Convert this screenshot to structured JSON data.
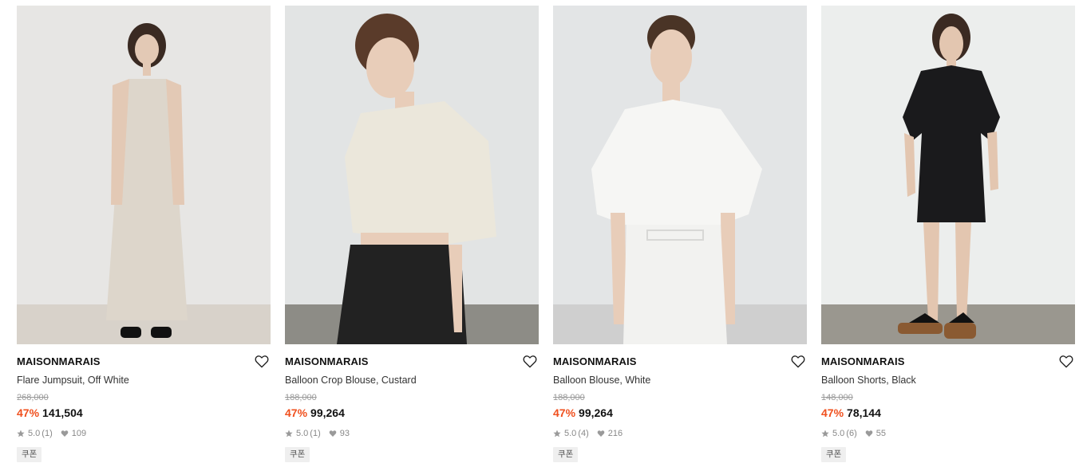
{
  "products": [
    {
      "brand": "MAISONMARAIS",
      "name": "Flare Jumpsuit, Off White",
      "original_price": "268,000",
      "discount": "47%",
      "price": "141,504",
      "rating": "5.0",
      "review_count": "(1)",
      "likes": "109",
      "badge": "쿠폰",
      "photo": {
        "bg": "#e7e6e4",
        "floor": "#d8d2ca",
        "garment": "#ddd6cb",
        "lower": "#ddd6cb",
        "hair": "#3a2a22",
        "skin": "#e3c9b5",
        "type": "jumpsuit"
      }
    },
    {
      "brand": "MAISONMARAIS",
      "name": "Balloon Crop Blouse, Custard",
      "original_price": "188,000",
      "discount": "47%",
      "price": "99,264",
      "rating": "5.0",
      "review_count": "(1)",
      "likes": "93",
      "badge": "쿠폰",
      "photo": {
        "bg": "#e2e4e4",
        "floor": "#8d8c86",
        "garment": "#ebe7db",
        "lower": "#222222",
        "hair": "#5a3b2a",
        "skin": "#e8cdb9",
        "type": "crop"
      }
    },
    {
      "brand": "MAISONMARAIS",
      "name": "Balloon Blouse, White",
      "original_price": "188,000",
      "discount": "47%",
      "price": "99,264",
      "rating": "5.0",
      "review_count": "(4)",
      "likes": "216",
      "badge": "쿠폰",
      "photo": {
        "bg": "#e3e5e6",
        "floor": "#cfcfcf",
        "garment": "#f6f6f4",
        "lower": "#f2f2f0",
        "hair": "#4a3426",
        "skin": "#e8cdb9",
        "type": "blouse"
      }
    },
    {
      "brand": "MAISONMARAIS",
      "name": "Balloon Shorts, Black",
      "original_price": "148,000",
      "discount": "47%",
      "price": "78,144",
      "rating": "5.0",
      "review_count": "(6)",
      "likes": "55",
      "badge": "쿠폰",
      "photo": {
        "bg": "#eceeed",
        "floor": "#9a978f",
        "garment": "#1a1a1c",
        "lower": "#1a1a1c",
        "hair": "#3b2a22",
        "skin": "#e3c6b0",
        "type": "shorts"
      }
    }
  ],
  "colors": {
    "discount": "#f0501e",
    "muted": "#999999",
    "badge_bg": "#efefef"
  },
  "icons": {
    "like": "heart-outline-icon",
    "rating": "star-icon",
    "likes_count": "heart-filled-icon"
  }
}
